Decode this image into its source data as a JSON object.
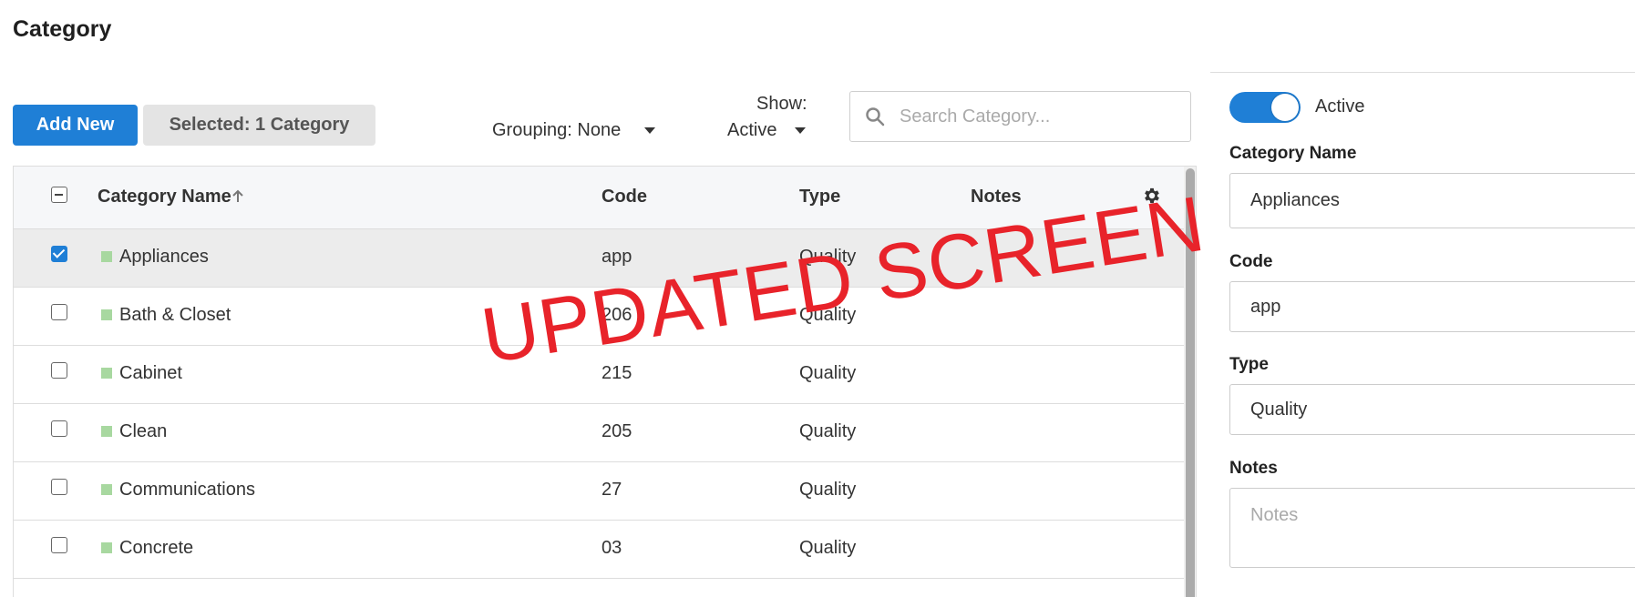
{
  "page": {
    "title": "Category"
  },
  "toolbar": {
    "add_new": "Add New",
    "selected": "Selected: 1 Category",
    "grouping": "Grouping: None",
    "show_label": "Show:",
    "show_value": "Active",
    "search_placeholder": "Search Category..."
  },
  "table": {
    "columns": [
      "Category Name",
      "Code",
      "Type",
      "Notes"
    ],
    "rows": [
      {
        "name": "Appliances",
        "code": "app",
        "type": "Quality",
        "notes": "",
        "checked": true
      },
      {
        "name": "Bath & Closet",
        "code": "206",
        "type": "Quality",
        "notes": "",
        "checked": false
      },
      {
        "name": "Cabinet",
        "code": "215",
        "type": "Quality",
        "notes": "",
        "checked": false
      },
      {
        "name": "Clean",
        "code": "205",
        "type": "Quality",
        "notes": "",
        "checked": false
      },
      {
        "name": "Communications",
        "code": "27",
        "type": "Quality",
        "notes": "",
        "checked": false
      },
      {
        "name": "Concrete",
        "code": "03",
        "type": "Quality",
        "notes": "",
        "checked": false
      }
    ],
    "sort_column": "Category Name",
    "sort_direction": "ascending"
  },
  "watermark": "UPDATED SCREEN",
  "detail": {
    "active_label": "Active",
    "active": true,
    "name_label": "Category Name",
    "name_value": "Appliances",
    "code_label": "Code",
    "code_value": "app",
    "type_label": "Type",
    "type_value": "Quality",
    "notes_label": "Notes",
    "notes_placeholder": "Notes"
  },
  "colors": {
    "accent": "#1f7fd6",
    "swatch": "#a8d8a0",
    "watermark": "#e8232a"
  }
}
